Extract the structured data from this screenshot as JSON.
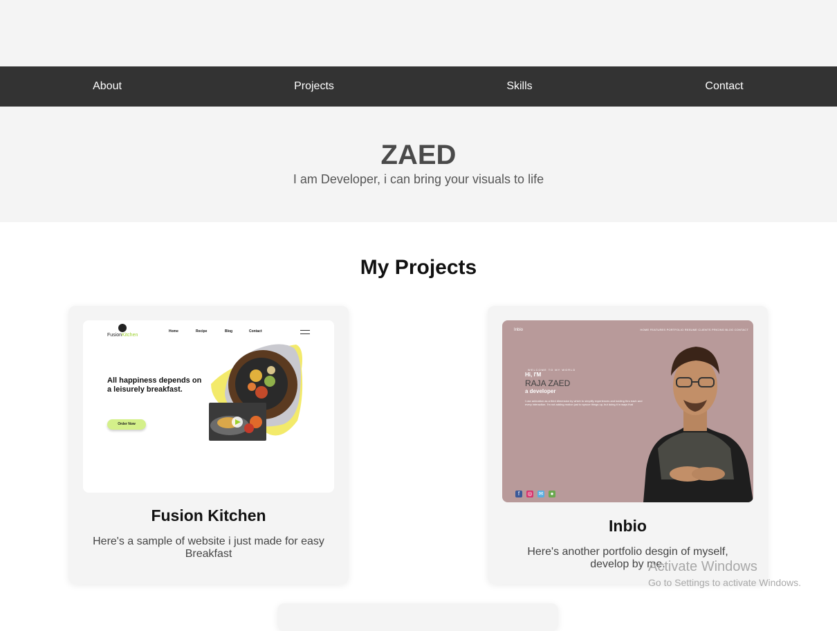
{
  "nav": {
    "about": "About",
    "projects": "Projects",
    "skills": "Skills",
    "contact": "Contact"
  },
  "hero": {
    "title": "ZAED",
    "subtitle": "I am Developer, i can bring your visuals to life"
  },
  "projects": {
    "heading": "My Projects",
    "items": [
      {
        "title": "Fusion Kitchen",
        "description": "Here's a sample of website i just made for easy Breakfast",
        "thumb": {
          "logo_a": "Fusion",
          "logo_b": "Kitchen",
          "menu": [
            "Home",
            "Recipe",
            "Blog",
            "Contact"
          ],
          "headline": "All happiness depends on a leisurely breakfast.",
          "cta": "Order Now"
        }
      },
      {
        "title": "Inbio",
        "description": "Here's another portfolio desgin of myself, develop by me.",
        "thumb": {
          "brand": "Inbio",
          "menu": "HOME  FEATURES  PORTFOLIO  RESUME  CLIENTS  PRICING  BLOG  CONTACT",
          "welcome": "WELCOME TO MY WORLD",
          "hi": "Hi, I'M",
          "name": "RAJA ZAED",
          "role": "a developer",
          "bio": "I use animation as a third dimension by which to simplify experiences and kuiding thro each and every interaction. I'm not adding motion just to spruce things up, but doing it in ways that"
        }
      }
    ]
  },
  "watermark": {
    "line1": "Activate Windows",
    "line2": "Go to Settings to activate Windows."
  }
}
